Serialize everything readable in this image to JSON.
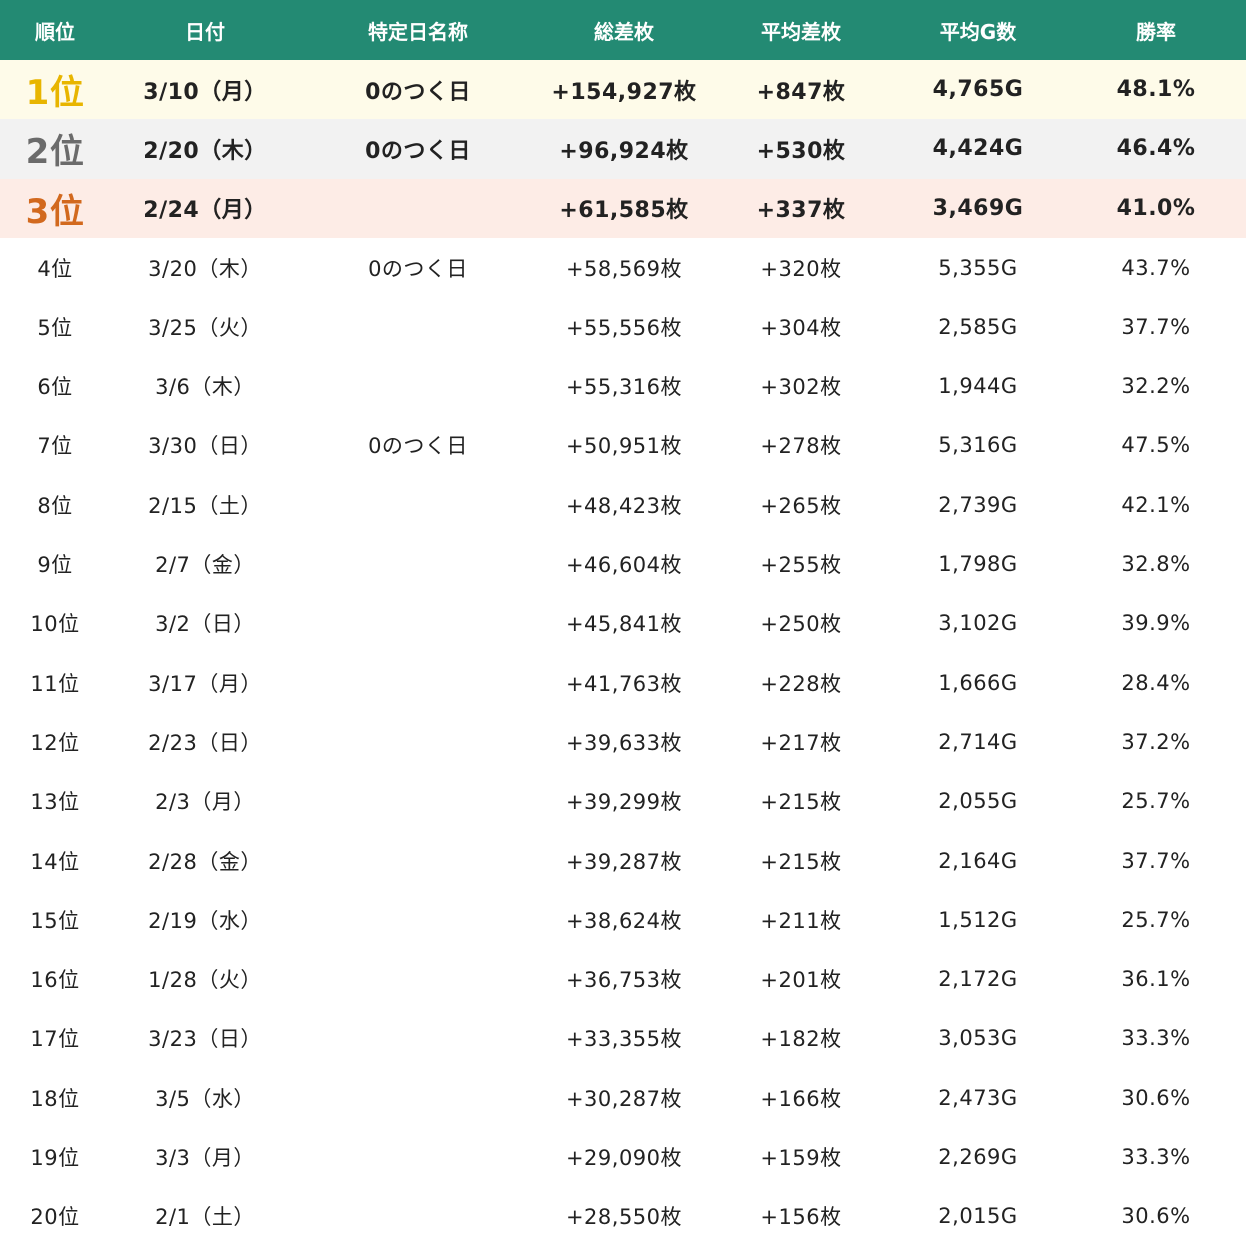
{
  "headers": [
    "順位",
    "日付",
    "特定日名称",
    "総差枚",
    "平均差枚",
    "平均G数",
    "勝率"
  ],
  "rows": [
    {
      "rank": "1位",
      "date": "3/10（月）",
      "name": "0のつく日",
      "total": "+154,927枚",
      "avg": "+847枚",
      "games": "4,765G",
      "win": "48.1%"
    },
    {
      "rank": "2位",
      "date": "2/20（木）",
      "name": "0のつく日",
      "total": "+96,924枚",
      "avg": "+530枚",
      "games": "4,424G",
      "win": "46.4%"
    },
    {
      "rank": "3位",
      "date": "2/24（月）",
      "name": "",
      "total": "+61,585枚",
      "avg": "+337枚",
      "games": "3,469G",
      "win": "41.0%"
    },
    {
      "rank": "4位",
      "date": "3/20（木）",
      "name": "0のつく日",
      "total": "+58,569枚",
      "avg": "+320枚",
      "games": "5,355G",
      "win": "43.7%"
    },
    {
      "rank": "5位",
      "date": "3/25（火）",
      "name": "",
      "total": "+55,556枚",
      "avg": "+304枚",
      "games": "2,585G",
      "win": "37.7%"
    },
    {
      "rank": "6位",
      "date": "3/6（木）",
      "name": "",
      "total": "+55,316枚",
      "avg": "+302枚",
      "games": "1,944G",
      "win": "32.2%"
    },
    {
      "rank": "7位",
      "date": "3/30（日）",
      "name": "0のつく日",
      "total": "+50,951枚",
      "avg": "+278枚",
      "games": "5,316G",
      "win": "47.5%"
    },
    {
      "rank": "8位",
      "date": "2/15（土）",
      "name": "",
      "total": "+48,423枚",
      "avg": "+265枚",
      "games": "2,739G",
      "win": "42.1%"
    },
    {
      "rank": "9位",
      "date": "2/7（金）",
      "name": "",
      "total": "+46,604枚",
      "avg": "+255枚",
      "games": "1,798G",
      "win": "32.8%"
    },
    {
      "rank": "10位",
      "date": "3/2（日）",
      "name": "",
      "total": "+45,841枚",
      "avg": "+250枚",
      "games": "3,102G",
      "win": "39.9%"
    },
    {
      "rank": "11位",
      "date": "3/17（月）",
      "name": "",
      "total": "+41,763枚",
      "avg": "+228枚",
      "games": "1,666G",
      "win": "28.4%"
    },
    {
      "rank": "12位",
      "date": "2/23（日）",
      "name": "",
      "total": "+39,633枚",
      "avg": "+217枚",
      "games": "2,714G",
      "win": "37.2%"
    },
    {
      "rank": "13位",
      "date": "2/3（月）",
      "name": "",
      "total": "+39,299枚",
      "avg": "+215枚",
      "games": "2,055G",
      "win": "25.7%"
    },
    {
      "rank": "14位",
      "date": "2/28（金）",
      "name": "",
      "total": "+39,287枚",
      "avg": "+215枚",
      "games": "2,164G",
      "win": "37.7%"
    },
    {
      "rank": "15位",
      "date": "2/19（水）",
      "name": "",
      "total": "+38,624枚",
      "avg": "+211枚",
      "games": "1,512G",
      "win": "25.7%"
    },
    {
      "rank": "16位",
      "date": "1/28（火）",
      "name": "",
      "total": "+36,753枚",
      "avg": "+201枚",
      "games": "2,172G",
      "win": "36.1%"
    },
    {
      "rank": "17位",
      "date": "3/23（日）",
      "name": "",
      "total": "+33,355枚",
      "avg": "+182枚",
      "games": "3,053G",
      "win": "33.3%"
    },
    {
      "rank": "18位",
      "date": "3/5（水）",
      "name": "",
      "total": "+30,287枚",
      "avg": "+166枚",
      "games": "2,473G",
      "win": "30.6%"
    },
    {
      "rank": "19位",
      "date": "3/3（月）",
      "name": "",
      "total": "+29,090枚",
      "avg": "+159枚",
      "games": "2,269G",
      "win": "33.3%"
    },
    {
      "rank": "20位",
      "date": "2/1（土）",
      "name": "",
      "total": "+28,550枚",
      "avg": "+156枚",
      "games": "2,015G",
      "win": "30.6%"
    }
  ],
  "colors": {
    "header_bg": "#238a73",
    "gold": "#e8b500",
    "silver": "#6b6b6b",
    "bronze": "#d2691e"
  }
}
